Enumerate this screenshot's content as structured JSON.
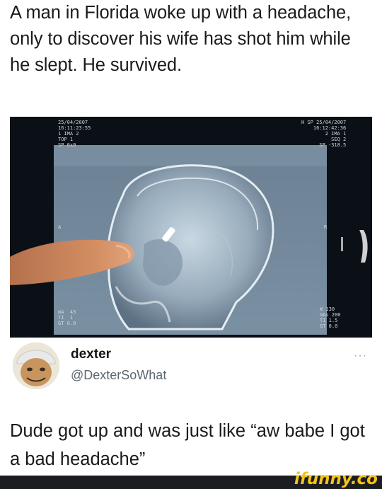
{
  "headline": "A man in Florida woke up with a headache, only to discover his wife has shot him while he slept. He survived.",
  "xray": {
    "overlay_top_left": "25/04/2007\n16:11:23:55\n1 IMA 2\nTOP 1\nSP 0x0",
    "overlay_top_right": "H SP 25/04/2007\n16:12:42:36\n2 IMA 1\nSEQ 2\nSP -318.5",
    "overlay_bottom_left": "mA  43\nTI  1\nGT 0.0",
    "overlay_bottom_right": "W 130\nmAs 200\nTI 1.5\nGT 0.0",
    "marker_left": "A",
    "marker_right": "R"
  },
  "tweet": {
    "display_name": "dexter",
    "handle": "@DexterSoWhat",
    "more_glyph": "···",
    "text": "Dude got up and was just like “aw babe I got a bad headache”"
  },
  "watermark": {
    "text": "ifunny.co"
  }
}
